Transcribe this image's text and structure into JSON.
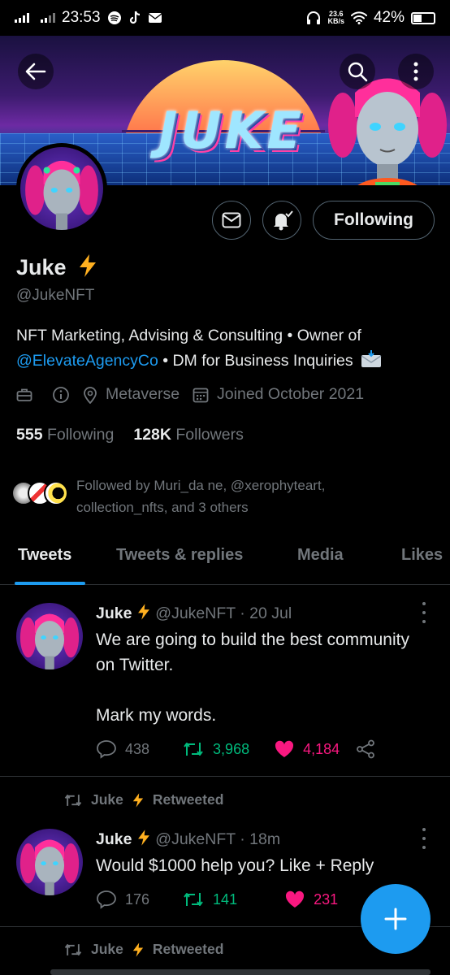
{
  "status_bar": {
    "time": "23:53",
    "net_speed_value": "23.6",
    "net_speed_unit": "KB/s",
    "battery_percent": "42%",
    "battery_level": 0.42
  },
  "banner": {
    "title": "JUKE"
  },
  "profile": {
    "name": "Juke",
    "handle": "@JukeNFT",
    "bio_line1": "NFT Marketing, Advising & Consulting • Owner of",
    "bio_link": "@ElevateAgencyCo",
    "bio_line2_rest": " • DM for Business Inquiries",
    "location": "Metaverse",
    "joined": "Joined October 2021",
    "following_count": "555",
    "following_label": "Following",
    "followers_count": "128K",
    "followers_label": "Followers",
    "followed_by": "Followed by Muri_da ne, @xerophyteart, collection_nfts, and 3 others",
    "follow_button": "Following"
  },
  "tabs": [
    {
      "label": "Tweets",
      "active": true
    },
    {
      "label": "Tweets & replies",
      "active": false
    },
    {
      "label": "Media",
      "active": false
    },
    {
      "label": "Likes",
      "active": false
    }
  ],
  "tweets": [
    {
      "name": "Juke",
      "handle": "@JukeNFT",
      "time": "· 20 Jul",
      "text": "We are going to build the best community on Twitter.\n\nMark my words.",
      "replies": "438",
      "retweets": "3,968",
      "likes": "4,184"
    },
    {
      "retweeted_by": "Juke",
      "retweeted_label": "Retweeted",
      "name": "Juke",
      "handle": "@JukeNFT",
      "time": "· 18m",
      "text": "Would $1000 help you? Like + Reply",
      "replies": "176",
      "retweets": "141",
      "likes": "231"
    },
    {
      "retweeted_by": "Juke",
      "retweeted_label": "Retweeted"
    }
  ],
  "colors": {
    "accent": "#1d9bf0",
    "retweet": "#00ba7c",
    "like": "#f91880",
    "secondary_text": "#71767b"
  }
}
